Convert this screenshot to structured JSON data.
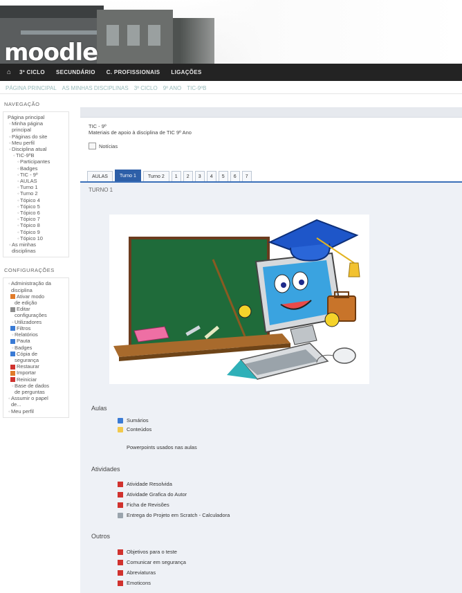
{
  "site": {
    "logo": "moodle",
    "home_icon": "home-icon",
    "nav": [
      "3º CICLO",
      "SECUNDÁRIO",
      "C. PROFISSIONAIS",
      "LIGAÇÕES"
    ],
    "breadcrumb": [
      "PÁGINA PRINCIPAL",
      "AS MINHAS DISCIPLINAS",
      "3º CICLO",
      "9º ANO",
      "TIC-9ºB"
    ]
  },
  "navigation": {
    "title": "NAVEGAÇÃO",
    "items": [
      {
        "label": "Página principal",
        "indent": 0,
        "bullet": ""
      },
      {
        "label": "Minha página",
        "indent": 1,
        "bullet": "◦"
      },
      {
        "label": "principal",
        "indent": 1,
        "bullet": ""
      },
      {
        "label": "Páginas do site",
        "indent": 1,
        "bullet": "◦"
      },
      {
        "label": "Meu perfil",
        "indent": 1,
        "bullet": "◦"
      },
      {
        "label": "Disciplina atual",
        "indent": 1,
        "bullet": "◦"
      },
      {
        "label": "TIC-9ºB",
        "indent": 2,
        "bullet": "◦"
      },
      {
        "label": "Participantes",
        "indent": 3,
        "bullet": "◦"
      },
      {
        "label": "Badges",
        "indent": 3,
        "bullet": "◦"
      },
      {
        "label": "TIC - 9º",
        "indent": 3,
        "bullet": "◦"
      },
      {
        "label": "AULAS",
        "indent": 3,
        "bullet": "◦"
      },
      {
        "label": "Turno 1",
        "indent": 3,
        "bullet": "◦"
      },
      {
        "label": "Turno 2",
        "indent": 3,
        "bullet": "◦"
      },
      {
        "label": "Tópico 4",
        "indent": 3,
        "bullet": "◦"
      },
      {
        "label": "Tópico 5",
        "indent": 3,
        "bullet": "◦"
      },
      {
        "label": "Tópico 6",
        "indent": 3,
        "bullet": "◦"
      },
      {
        "label": "Tópico 7",
        "indent": 3,
        "bullet": "◦"
      },
      {
        "label": "Tópico 8",
        "indent": 3,
        "bullet": "◦"
      },
      {
        "label": "Tópico 9",
        "indent": 3,
        "bullet": "◦"
      },
      {
        "label": "Tópico 10",
        "indent": 3,
        "bullet": "◦"
      },
      {
        "label": "As minhas",
        "indent": 1,
        "bullet": "◦"
      },
      {
        "label": "disciplinas",
        "indent": 1,
        "bullet": ""
      }
    ]
  },
  "configuration": {
    "title": "CONFIGURAÇÕES",
    "items": [
      {
        "label": "Administração da",
        "indent": 1,
        "icon": "bullet"
      },
      {
        "label": "disciplina",
        "indent": 1,
        "icon": "none"
      },
      {
        "label": "Ativar modo",
        "indent": 2,
        "icon": "pencil-icon"
      },
      {
        "label": "de edição",
        "indent": 2,
        "icon": "none"
      },
      {
        "label": "Editar",
        "indent": 2,
        "icon": "settings-icon"
      },
      {
        "label": "configurações",
        "indent": 2,
        "icon": "none"
      },
      {
        "label": "Utilizadores",
        "indent": 2,
        "icon": "bullet"
      },
      {
        "label": "Filtros",
        "indent": 2,
        "icon": "filter-icon"
      },
      {
        "label": "Relatórios",
        "indent": 2,
        "icon": "bullet"
      },
      {
        "label": "Pauta",
        "indent": 2,
        "icon": "grades-icon"
      },
      {
        "label": "Badges",
        "indent": 2,
        "icon": "bullet"
      },
      {
        "label": "Cópia de",
        "indent": 2,
        "icon": "backup-icon"
      },
      {
        "label": "segurança",
        "indent": 2,
        "icon": "none"
      },
      {
        "label": "Restaurar",
        "indent": 2,
        "icon": "restore-icon"
      },
      {
        "label": "Importar",
        "indent": 2,
        "icon": "import-icon"
      },
      {
        "label": "Reiniciar",
        "indent": 2,
        "icon": "reset-icon"
      },
      {
        "label": "Base de dados",
        "indent": 2,
        "icon": "bullet"
      },
      {
        "label": "de perguntas",
        "indent": 2,
        "icon": "none"
      },
      {
        "label": "Assumir o papel",
        "indent": 1,
        "icon": "bullet"
      },
      {
        "label": "de...",
        "indent": 1,
        "icon": "none"
      },
      {
        "label": "Meu perfil",
        "indent": 1,
        "icon": "bullet"
      }
    ]
  },
  "course": {
    "code": "TIC - 9º",
    "description": "Materiais de apoio à disciplina de TIC 9º Ano",
    "news": "Notícias",
    "tabs": [
      "AULAS",
      "Turno 1",
      "Turno 2",
      "1",
      "2",
      "3",
      "4",
      "5",
      "6",
      "7"
    ],
    "active_tab": "Turno 1",
    "section_heading": "TURNO 1"
  },
  "sections": [
    {
      "title": "Aulas",
      "items": [
        {
          "label": "Sumários",
          "icon": "forum-icon"
        },
        {
          "label": "Conteúdos",
          "icon": "folder-icon"
        },
        {
          "label": "Powerpoints usados nas aulas",
          "icon": "none"
        }
      ]
    },
    {
      "title": "Atividades",
      "items": [
        {
          "label": "Atividade Resolvida",
          "icon": "pdf-icon"
        },
        {
          "label": "Atividade Grafica do Autor",
          "icon": "pdf-icon"
        },
        {
          "label": "Ficha de Revisões",
          "icon": "pdf-icon"
        },
        {
          "label": "Entrega do Projeto em Scratch - Calculadora",
          "icon": "assignment-icon"
        }
      ]
    },
    {
      "title": "Outros",
      "items": [
        {
          "label": "Objetivos para o teste",
          "icon": "pdf-icon"
        },
        {
          "label": "Comunicar em segurança",
          "icon": "pdf-icon"
        },
        {
          "label": "Abreviaturas",
          "icon": "pdf-icon"
        },
        {
          "label": "Emoticons",
          "icon": "pdf-icon"
        }
      ]
    }
  ],
  "colors": {
    "accent": "#2d5fa8",
    "nav_bg": "#232323",
    "main_bg": "#eef1f6",
    "pdf_red": "#d0322e"
  }
}
